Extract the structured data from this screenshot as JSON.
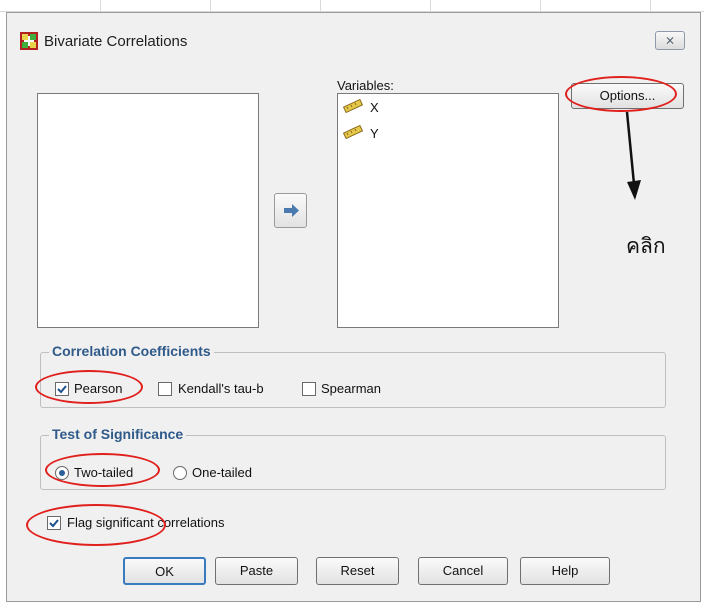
{
  "window": {
    "title": "Bivariate Correlations",
    "close_symbol": "⨯"
  },
  "variables": {
    "label": "Variables:",
    "items": [
      "X",
      "Y"
    ]
  },
  "move_button": {
    "icon": "right-arrow-icon"
  },
  "options_button": {
    "label": "Options..."
  },
  "correlation_coefficients": {
    "legend": "Correlation Coefficients",
    "options": [
      {
        "label": "Pearson",
        "checked": true
      },
      {
        "label": "Kendall's tau-b",
        "checked": false
      },
      {
        "label": "Spearman",
        "checked": false
      }
    ]
  },
  "test_of_significance": {
    "legend": "Test of Significance",
    "options": [
      {
        "label": "Two-tailed",
        "selected": true
      },
      {
        "label": "One-tailed",
        "selected": false
      }
    ]
  },
  "flag_significant": {
    "label": "Flag significant correlations",
    "checked": true
  },
  "buttons": {
    "ok": "OK",
    "paste": "Paste",
    "reset": "Reset",
    "cancel": "Cancel",
    "help": "Help"
  },
  "annotation": {
    "text": "คลิก",
    "color": "#e0201c"
  }
}
